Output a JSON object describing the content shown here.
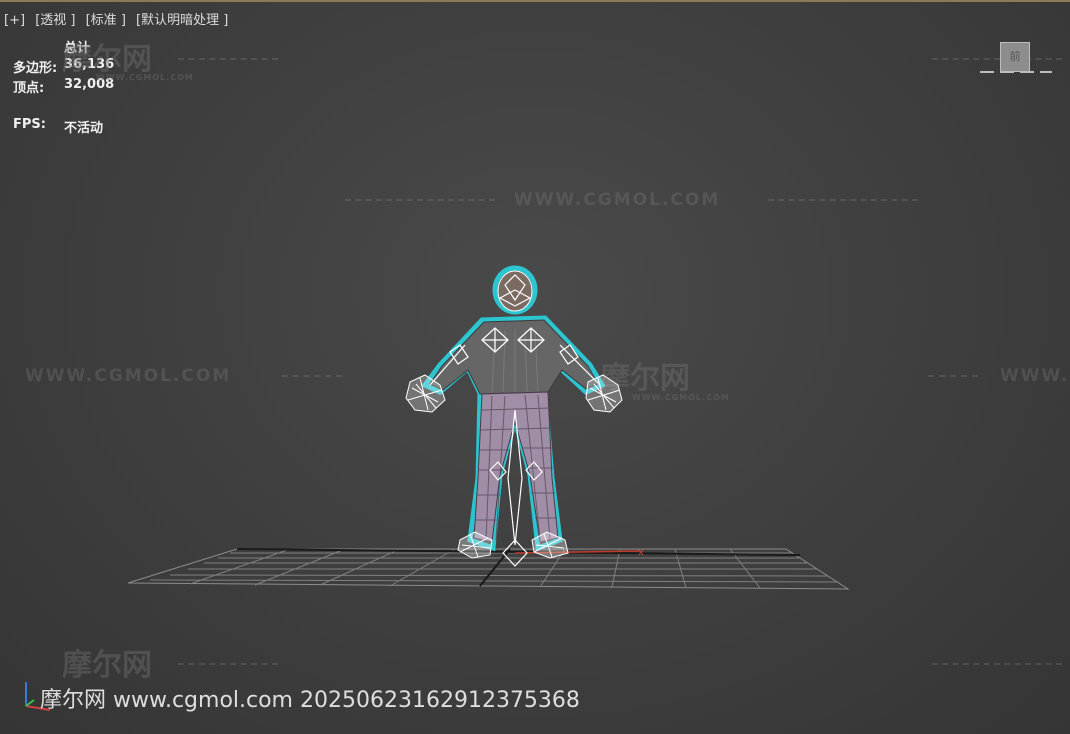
{
  "viewport_menu": {
    "items": [
      "[+]",
      "[透视 ]",
      "[标准 ]",
      "[默认明暗处理 ]"
    ]
  },
  "stats": {
    "header": "总计",
    "polys_label": "多边形:",
    "polys_value": "36,136",
    "verts_label": "顶点:",
    "verts_value": "32,008",
    "fps_label": "FPS:",
    "fps_value": "不活动"
  },
  "watermarks": {
    "site": "WWW.CGMOL.COM",
    "brand": "摩尔网",
    "brand_sub": "WWW.CGMOL.COM"
  },
  "viewcube_label": "前",
  "footer": {
    "text": "摩尔网 www.cgmol.com 2025062316291237536​8"
  },
  "colors": {
    "selection_outline": "#29d4e0",
    "wireframe": "#ffffff",
    "grid": "#9a9a9a",
    "shirt": "#6a6a6a",
    "pants": "#9a8aa0"
  },
  "icons": {
    "axis": "axis-gizmo-icon",
    "viewcube": "viewcube-icon"
  }
}
